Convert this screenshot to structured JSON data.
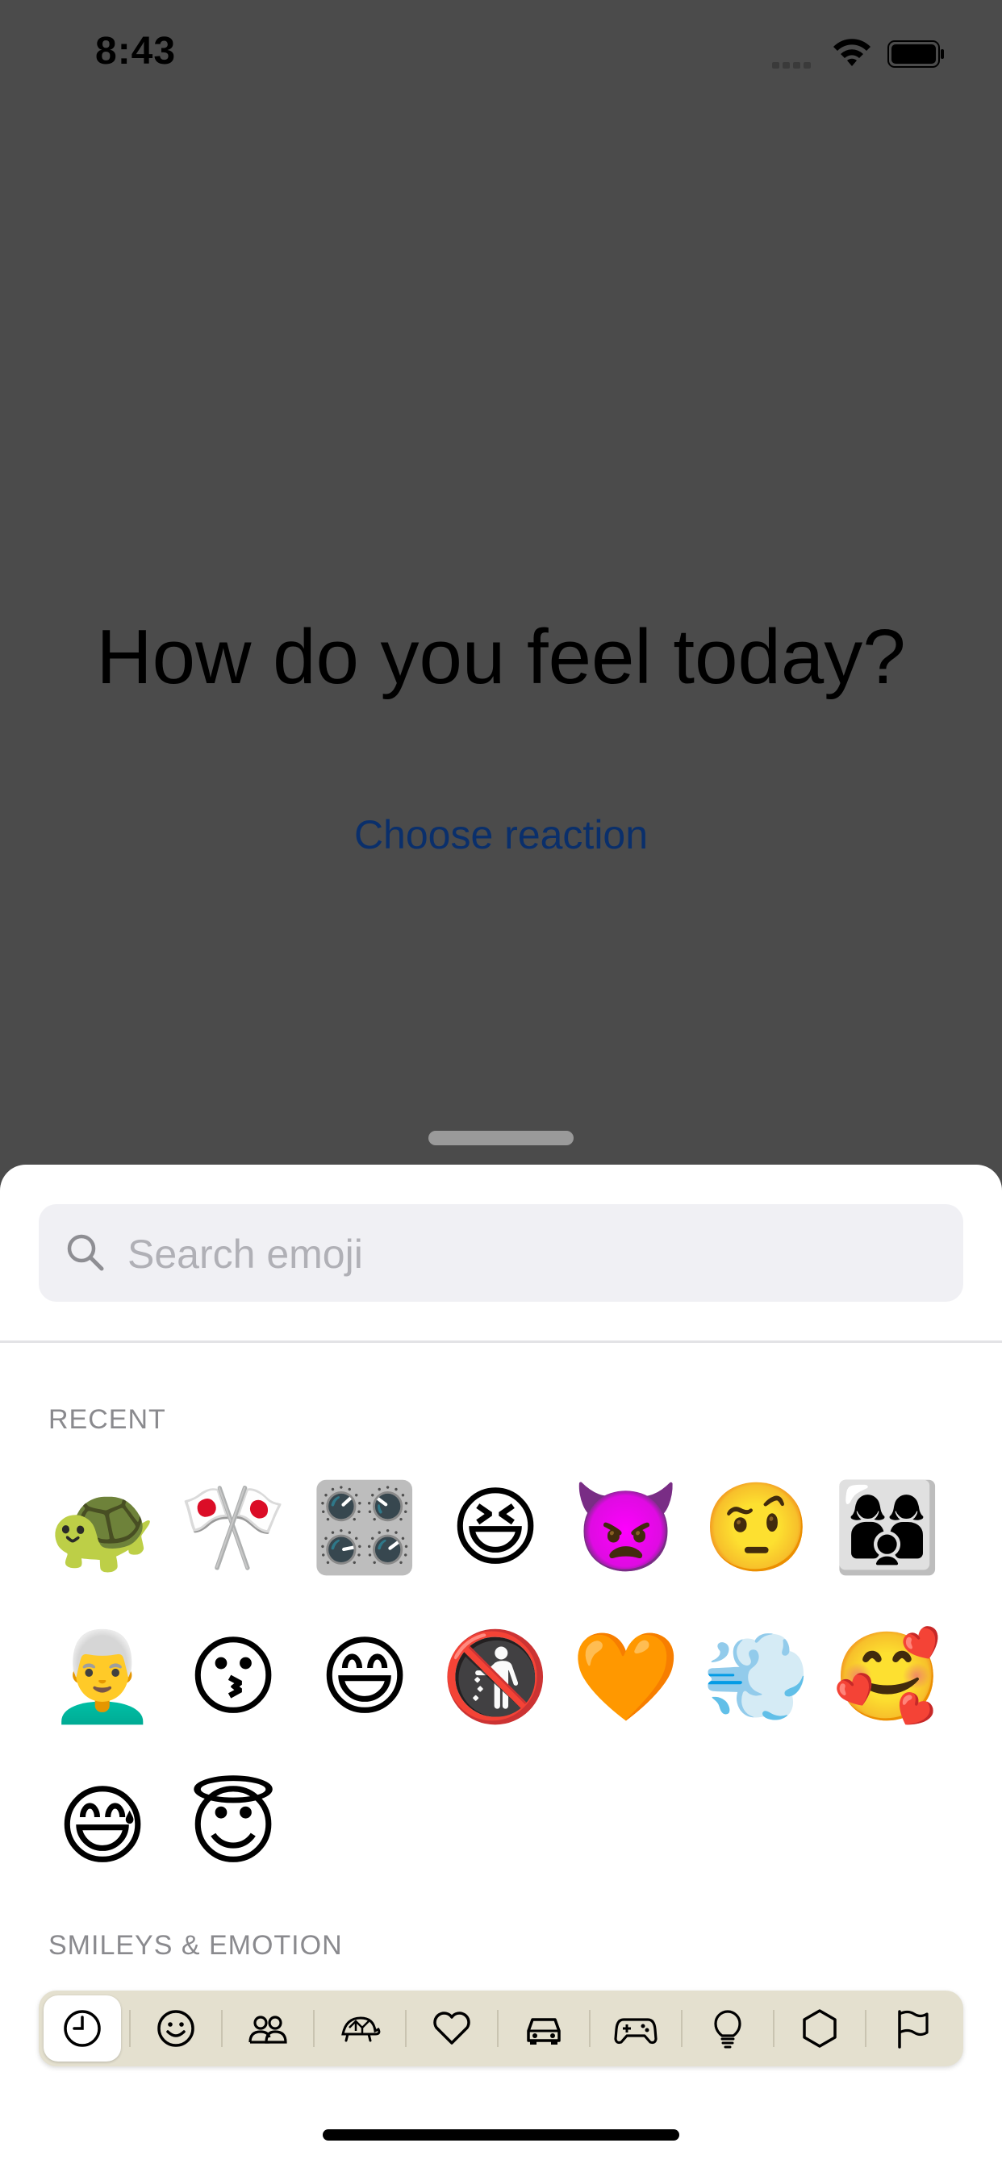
{
  "status_bar": {
    "time": "8:43"
  },
  "main": {
    "headline": "How do you feel today?",
    "choose_reaction": "Choose reaction"
  },
  "picker": {
    "search_placeholder": "Search emoji",
    "sections": [
      {
        "title": "RECENT",
        "emojis": [
          "🐢",
          "🎌",
          "🎛️",
          "😆",
          "👿",
          "🤨",
          "👩‍👩‍👦",
          "👨‍🦳",
          "😗",
          "😄",
          "🚯",
          "🧡",
          "💨",
          "🥰",
          "😅",
          "😇"
        ]
      },
      {
        "title": "SMILEYS & EMOTION",
        "emojis": []
      }
    ],
    "categories": [
      {
        "name": "recent",
        "icon": "clock-icon"
      },
      {
        "name": "smileys",
        "icon": "smiley-icon"
      },
      {
        "name": "people",
        "icon": "people-icon"
      },
      {
        "name": "animals",
        "icon": "turtle-icon"
      },
      {
        "name": "symbols-heart",
        "icon": "heart-icon"
      },
      {
        "name": "travel",
        "icon": "car-icon"
      },
      {
        "name": "activities",
        "icon": "gamepad-icon"
      },
      {
        "name": "objects",
        "icon": "lightbulb-icon"
      },
      {
        "name": "symbols",
        "icon": "hexagon-icon"
      },
      {
        "name": "flags",
        "icon": "flag-icon"
      }
    ]
  },
  "colors": {
    "overlay": "#4b4b4b",
    "link": "#0a2f6b",
    "search_bg": "#f0f0f4",
    "category_bar": "#e4e0cf"
  }
}
